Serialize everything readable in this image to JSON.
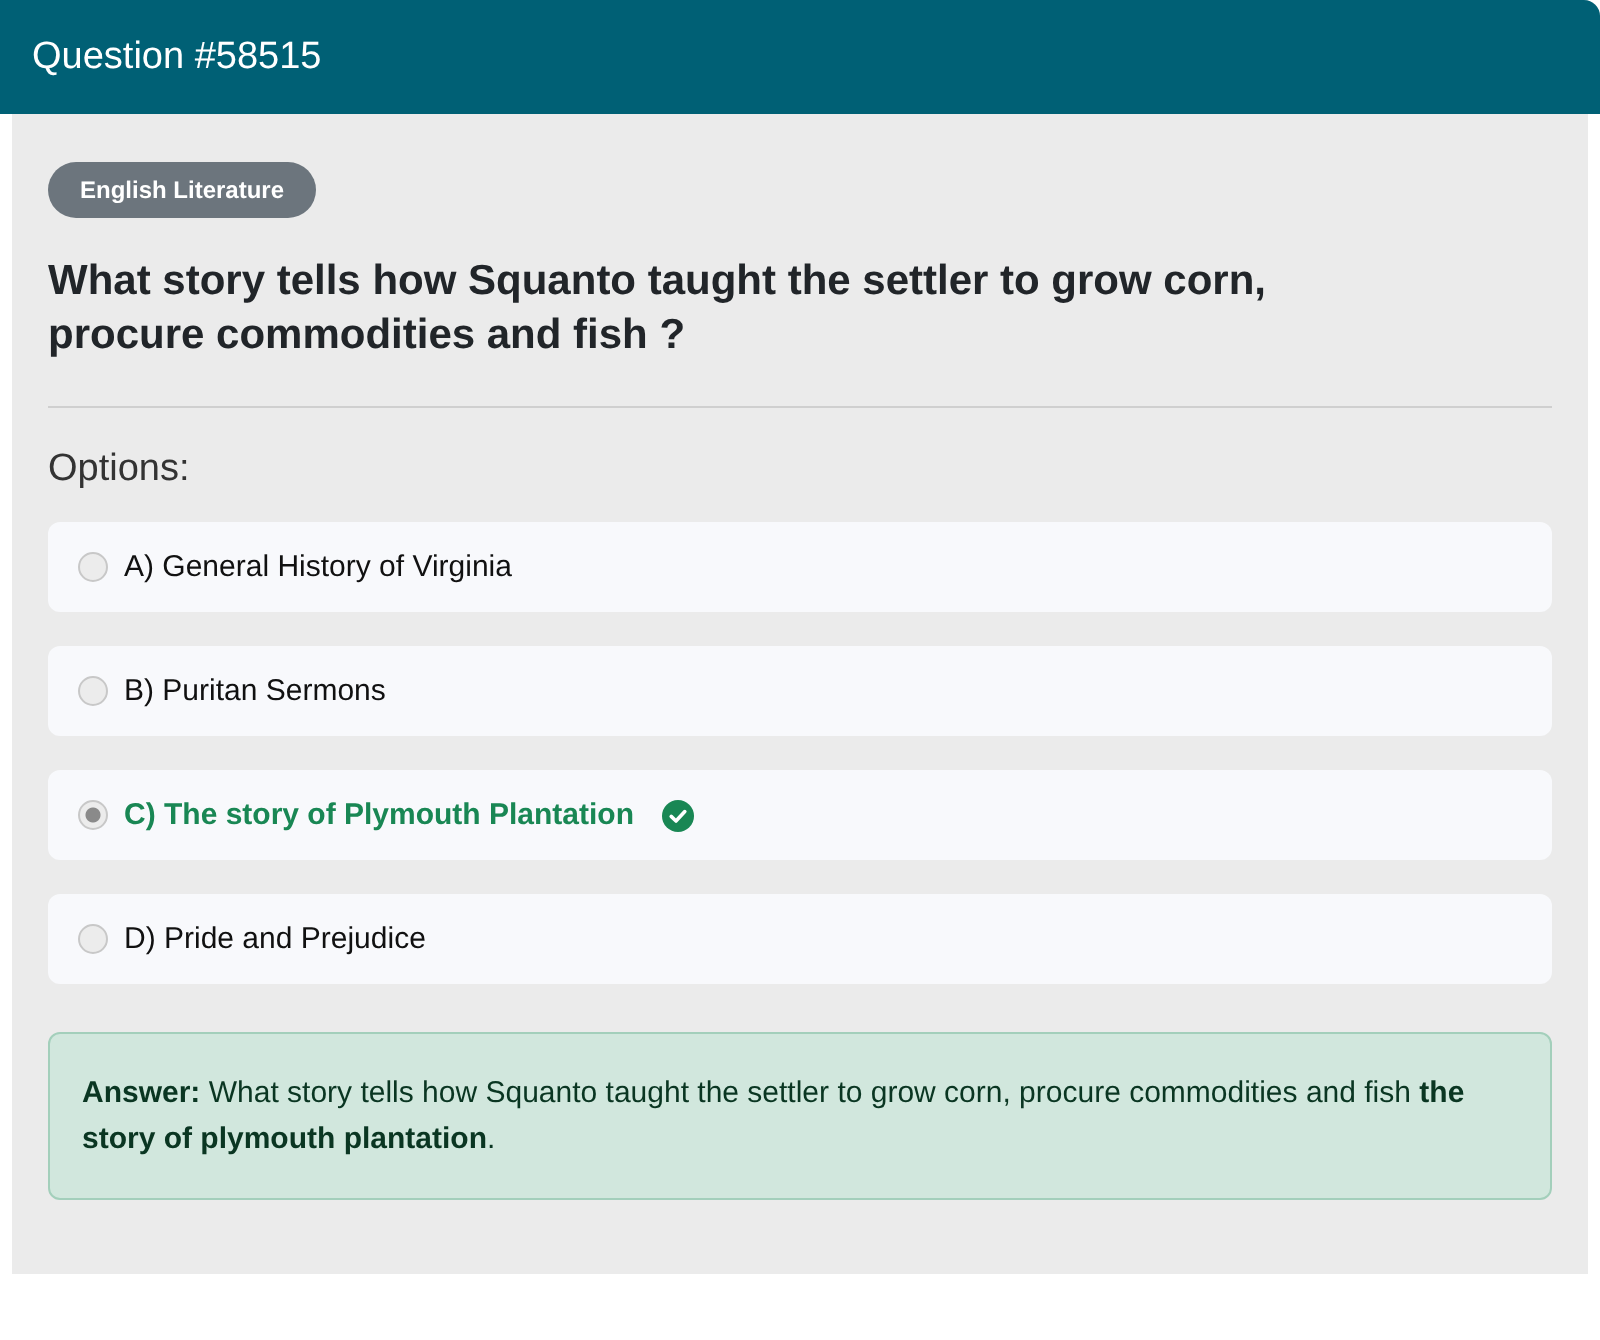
{
  "header": {
    "title": "Question #58515"
  },
  "question": {
    "category": "English Literature",
    "text": "What story tells how Squanto taught the settler to grow corn, procure commodities and fish ?"
  },
  "options_label": "Options:",
  "options": [
    {
      "label": "A) General History of Virginia",
      "selected": false,
      "correct": false
    },
    {
      "label": "B) Puritan Sermons",
      "selected": false,
      "correct": false
    },
    {
      "label": "C) The story of Plymouth Plantation",
      "selected": true,
      "correct": true
    },
    {
      "label": "D) Pride and Prejudice",
      "selected": false,
      "correct": false
    }
  ],
  "answer": {
    "text": "**Answer:** What story tells how Squanto taught the settler to grow corn, procure commodities and fish **the story of plymouth plantation**."
  }
}
